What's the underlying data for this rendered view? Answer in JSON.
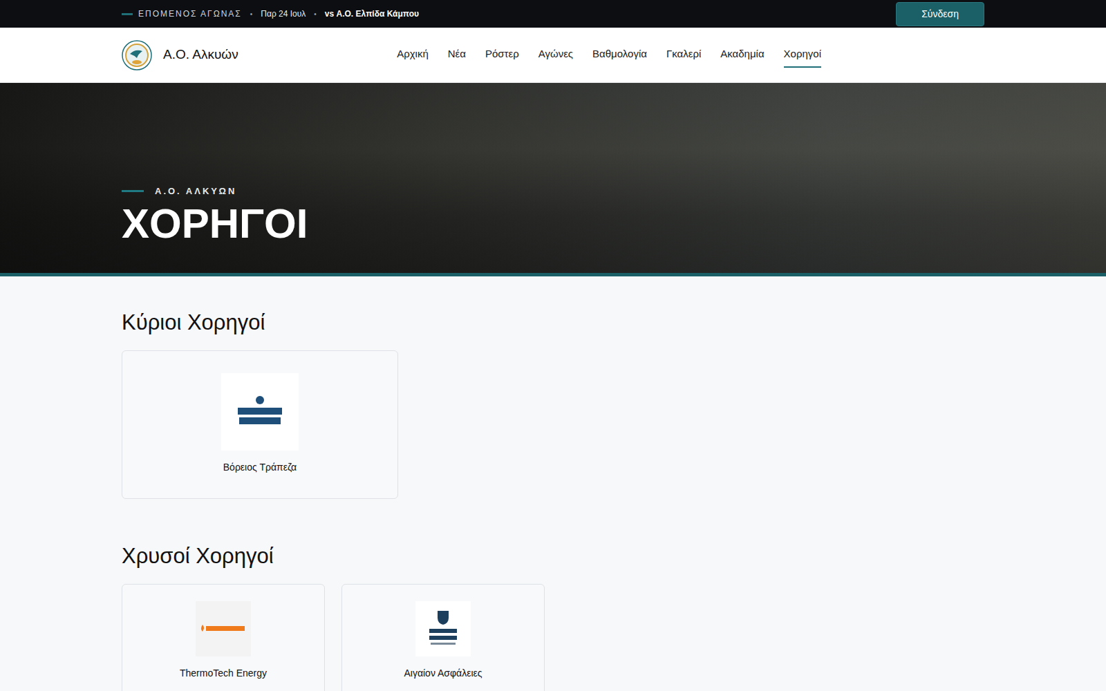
{
  "topbar": {
    "label": "ΕΠΟΜΕΝΟΣ ΑΓΩΝΑΣ",
    "separator": "•",
    "date": "Παρ 24 Ιουλ",
    "opponent": "vs Α.Ο. Ελπίδα Κάμπου",
    "login": "Σύνδεση"
  },
  "brand": {
    "name": "Α.Ο. Αλκυών"
  },
  "nav": [
    {
      "label": "Αρχική",
      "selected": false
    },
    {
      "label": "Νέα",
      "selected": false
    },
    {
      "label": "Ρόστερ",
      "selected": false
    },
    {
      "label": "Αγώνες",
      "selected": false
    },
    {
      "label": "Βαθμολογία",
      "selected": false
    },
    {
      "label": "Γκαλερί",
      "selected": false
    },
    {
      "label": "Ακαδημία",
      "selected": false
    },
    {
      "label": "Χορηγοί",
      "selected": true
    }
  ],
  "hero": {
    "eyebrow": "Α.Ο. ΑΛΚΥΩΝ",
    "title": "ΧΟΡΗΓΟΙ"
  },
  "tiers": [
    {
      "title": "Κύριοι Χορηγοί",
      "kind": "main",
      "sponsors": [
        {
          "name": "Βόρειος Τράπεζα"
        }
      ]
    },
    {
      "title": "Χρυσοί Χορηγοί",
      "kind": "gold",
      "sponsors": [
        {
          "name": "ThermoTech Energy"
        },
        {
          "name": "Αιγαίον Ασφάλειες"
        }
      ]
    }
  ]
}
